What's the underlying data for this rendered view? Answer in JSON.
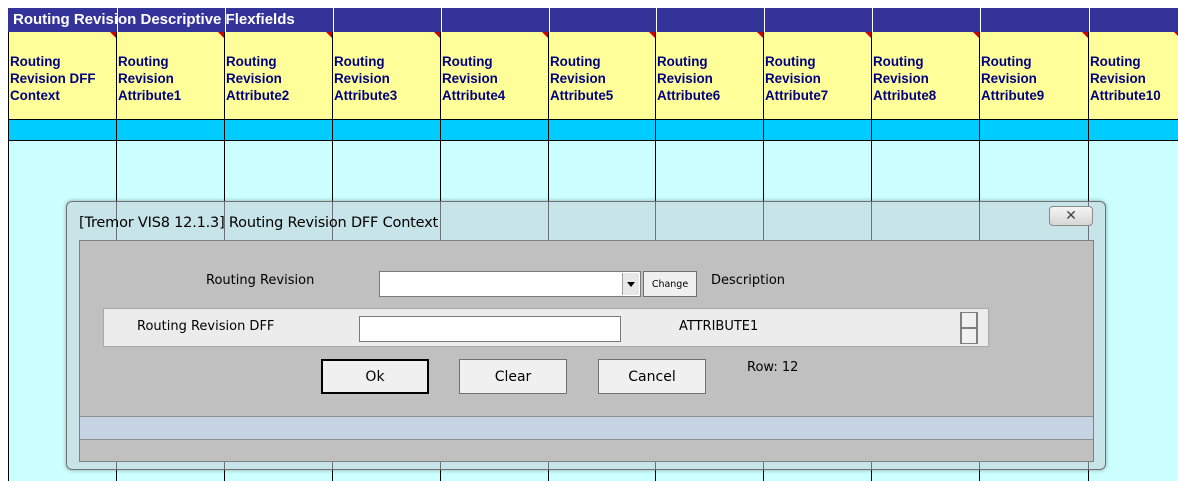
{
  "sheet": {
    "title": "Routing Revision Descriptive Flexfields",
    "columns": [
      {
        "lines": [
          "Routing",
          "Revision DFF",
          "Context"
        ]
      },
      {
        "lines": [
          "Routing",
          "Revision",
          "Attribute1"
        ]
      },
      {
        "lines": [
          "Routing",
          "Revision",
          "Attribute2"
        ]
      },
      {
        "lines": [
          "Routing",
          "Revision",
          "Attribute3"
        ]
      },
      {
        "lines": [
          "Routing",
          "Revision",
          "Attribute4"
        ]
      },
      {
        "lines": [
          "Routing",
          "Revision",
          "Attribute5"
        ]
      },
      {
        "lines": [
          "Routing",
          "Revision",
          "Attribute6"
        ]
      },
      {
        "lines": [
          "Routing",
          "Revision",
          "Attribute7"
        ]
      },
      {
        "lines": [
          "Routing",
          "Revision",
          "Attribute8"
        ]
      },
      {
        "lines": [
          "Routing",
          "Revision",
          "Attribute9"
        ]
      },
      {
        "lines": [
          "Routing",
          "Revision",
          "Attribute10"
        ]
      }
    ],
    "colors": {
      "title_bg": "#333399",
      "header_bg": "#ffff99",
      "header_text": "#000080",
      "band_bg": "#00ccff",
      "data_bg": "#ccffff"
    }
  },
  "dialog": {
    "title": "[Tremor VIS8 12.1.3] Routing Revision DFF Context",
    "close_icon": "close-icon",
    "close_glyph": "✕",
    "routing_revision_label": "Routing Revision",
    "routing_revision_value": "",
    "change_label": "Change",
    "description_label": "Description",
    "dff_label": "Routing Revision DFF",
    "dff_value": "",
    "attribute_label": "ATTRIBUTE1",
    "ok_label": "Ok",
    "clear_label": "Clear",
    "cancel_label": "Cancel",
    "row_label": "Row: 12"
  }
}
